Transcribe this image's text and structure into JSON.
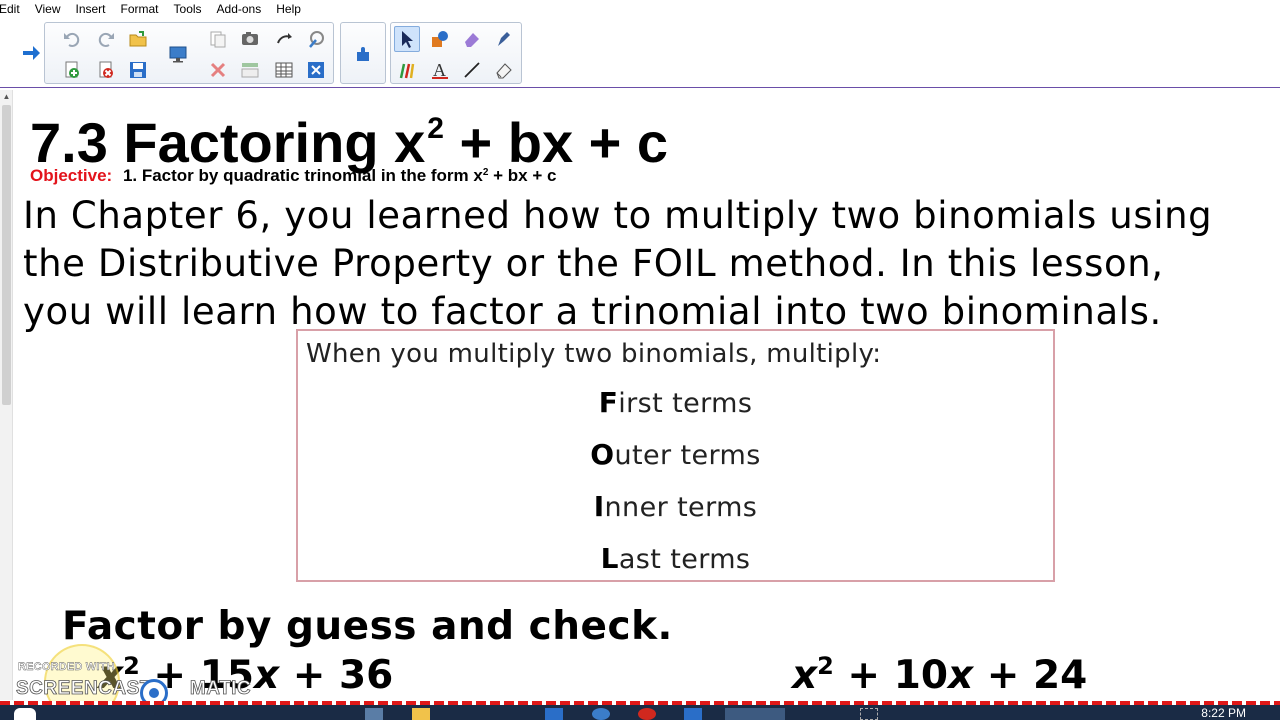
{
  "menu": [
    "Edit",
    "View",
    "Insert",
    "Format",
    "Tools",
    "Add-ons",
    "Help"
  ],
  "toolbar": {
    "buttons": [
      "forward-arrow",
      "undo",
      "redo",
      "open-folder",
      "new-page",
      "delete-page",
      "save",
      "screen-shade",
      "copy-page",
      "camera",
      "screen-capture",
      "magic-pen",
      "delete",
      "table-view",
      "grid",
      "close-box",
      "add-ons",
      "select-tool",
      "shapes",
      "eraser-shape",
      "pen-tool",
      "creative-pens",
      "text-tool",
      "line-tool",
      "eraser"
    ]
  },
  "page": {
    "title_main": "7.3 Factoring x",
    "title_sup": "2",
    "title_rest": " + bx + c",
    "objective_label": "Objective:",
    "objective_text": "1. Factor by quadratic trinomial in the form x",
    "objective_sup": "2",
    "objective_rest": " + bx + c",
    "intro_lines": [
      "In Chapter 6, you learned how to multiply two binomials using",
      "the Distributive Property or the FOIL method. In this lesson,",
      "you will learn how to factor a trinomial into two binominals."
    ],
    "foil": {
      "heading": "When you multiply two binomials, multiply:",
      "rows": [
        {
          "letter": "F",
          "rest": "irst terms"
        },
        {
          "letter": "O",
          "rest": "uter terms"
        },
        {
          "letter": "I",
          "rest": "nner terms"
        },
        {
          "letter": "L",
          "rest": "ast terms"
        }
      ]
    },
    "guess_heading": "Factor by guess and check.",
    "expr1": {
      "var": "x",
      "sup": "2",
      "mid": " + 15",
      "var2": "x",
      "end": " + 36"
    },
    "expr2": {
      "var": "x",
      "sup": "2",
      "mid": " + 10",
      "var2": "x",
      "end": " + 24"
    }
  },
  "watermark": {
    "top": "RECORDED WITH",
    "left": "SCREENCAST",
    "right": "MATIC"
  },
  "taskbar": {
    "clock": "8:22 PM"
  },
  "colors": {
    "objective_label": "#e3131b",
    "box_border": "#d8a0a8",
    "toolbar_underline": "#6a4ea8",
    "taskbar": "#1a2b45"
  }
}
